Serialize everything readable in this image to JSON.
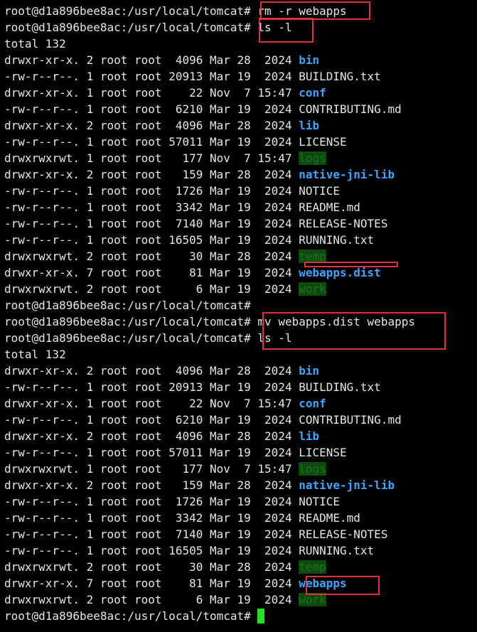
{
  "prompt": "root@d1a896bee8ac:/usr/local/tomcat#",
  "cmd_rm": "rm -r webapps",
  "cmd_ls1": "ls -l",
  "cmd_mv": "mv webapps.dist webapps",
  "cmd_ls2": "ls -l",
  "total": "total 132",
  "listing1": [
    {
      "meta": "drwxr-xr-x. 2 root root  4096 Mar 28  2024 ",
      "name": "bin",
      "kind": "dir"
    },
    {
      "meta": "-rw-r--r--. 1 root root 20913 Mar 19  2024 ",
      "name": "BUILDING.txt",
      "kind": "file"
    },
    {
      "meta": "drwxr-xr-x. 1 root root    22 Nov  7 15:47 ",
      "name": "conf",
      "kind": "dir"
    },
    {
      "meta": "-rw-r--r--. 1 root root  6210 Mar 19  2024 ",
      "name": "CONTRIBUTING.md",
      "kind": "file"
    },
    {
      "meta": "drwxr-xr-x. 2 root root  4096 Mar 28  2024 ",
      "name": "lib",
      "kind": "dir"
    },
    {
      "meta": "-rw-r--r--. 1 root root 57011 Mar 19  2024 ",
      "name": "LICENSE",
      "kind": "file"
    },
    {
      "meta": "drwxrwxrwt. 1 root root   177 Nov  7 15:47 ",
      "name": "logs",
      "kind": "dirw"
    },
    {
      "meta": "drwxr-xr-x. 2 root root   159 Mar 28  2024 ",
      "name": "native-jni-lib",
      "kind": "dir"
    },
    {
      "meta": "-rw-r--r--. 1 root root  1726 Mar 19  2024 ",
      "name": "NOTICE",
      "kind": "file"
    },
    {
      "meta": "-rw-r--r--. 1 root root  3342 Mar 19  2024 ",
      "name": "README.md",
      "kind": "file"
    },
    {
      "meta": "-rw-r--r--. 1 root root  7140 Mar 19  2024 ",
      "name": "RELEASE-NOTES",
      "kind": "file"
    },
    {
      "meta": "-rw-r--r--. 1 root root 16505 Mar 19  2024 ",
      "name": "RUNNING.txt",
      "kind": "file"
    },
    {
      "meta": "drwxrwxrwt. 2 root root    30 Mar 28  2024 ",
      "name": "temp",
      "kind": "dirw"
    },
    {
      "meta": "drwxr-xr-x. 7 root root    81 Mar 19  2024 ",
      "name": "webapps.dist",
      "kind": "dir"
    },
    {
      "meta": "drwxrwxrwt. 2 root root     6 Mar 19  2024 ",
      "name": "work",
      "kind": "dirw"
    }
  ],
  "listing2": [
    {
      "meta": "drwxr-xr-x. 2 root root  4096 Mar 28  2024 ",
      "name": "bin",
      "kind": "dir"
    },
    {
      "meta": "-rw-r--r--. 1 root root 20913 Mar 19  2024 ",
      "name": "BUILDING.txt",
      "kind": "file"
    },
    {
      "meta": "drwxr-xr-x. 1 root root    22 Nov  7 15:47 ",
      "name": "conf",
      "kind": "dir"
    },
    {
      "meta": "-rw-r--r--. 1 root root  6210 Mar 19  2024 ",
      "name": "CONTRIBUTING.md",
      "kind": "file"
    },
    {
      "meta": "drwxr-xr-x. 2 root root  4096 Mar 28  2024 ",
      "name": "lib",
      "kind": "dir"
    },
    {
      "meta": "-rw-r--r--. 1 root root 57011 Mar 19  2024 ",
      "name": "LICENSE",
      "kind": "file"
    },
    {
      "meta": "drwxrwxrwt. 1 root root   177 Nov  7 15:47 ",
      "name": "logs",
      "kind": "dirw"
    },
    {
      "meta": "drwxr-xr-x. 2 root root   159 Mar 28  2024 ",
      "name": "native-jni-lib",
      "kind": "dir"
    },
    {
      "meta": "-rw-r--r--. 1 root root  1726 Mar 19  2024 ",
      "name": "NOTICE",
      "kind": "file"
    },
    {
      "meta": "-rw-r--r--. 1 root root  3342 Mar 19  2024 ",
      "name": "README.md",
      "kind": "file"
    },
    {
      "meta": "-rw-r--r--. 1 root root  7140 Mar 19  2024 ",
      "name": "RELEASE-NOTES",
      "kind": "file"
    },
    {
      "meta": "-rw-r--r--. 1 root root 16505 Mar 19  2024 ",
      "name": "RUNNING.txt",
      "kind": "file"
    },
    {
      "meta": "drwxrwxrwt. 2 root root    30 Mar 28  2024 ",
      "name": "temp",
      "kind": "dirw"
    },
    {
      "meta": "drwxr-xr-x. 7 root root    81 Mar 19  2024 ",
      "name": "webapps",
      "kind": "dir"
    },
    {
      "meta": "drwxrwxrwt. 2 root root     6 Mar 19  2024 ",
      "name": "work",
      "kind": "dirw"
    }
  ],
  "colors": {
    "background": "#000000",
    "text": "#e6e6e6",
    "dir": "#3aa6ff",
    "highlight_box": "#e0303a",
    "cursor": "#22e022"
  }
}
